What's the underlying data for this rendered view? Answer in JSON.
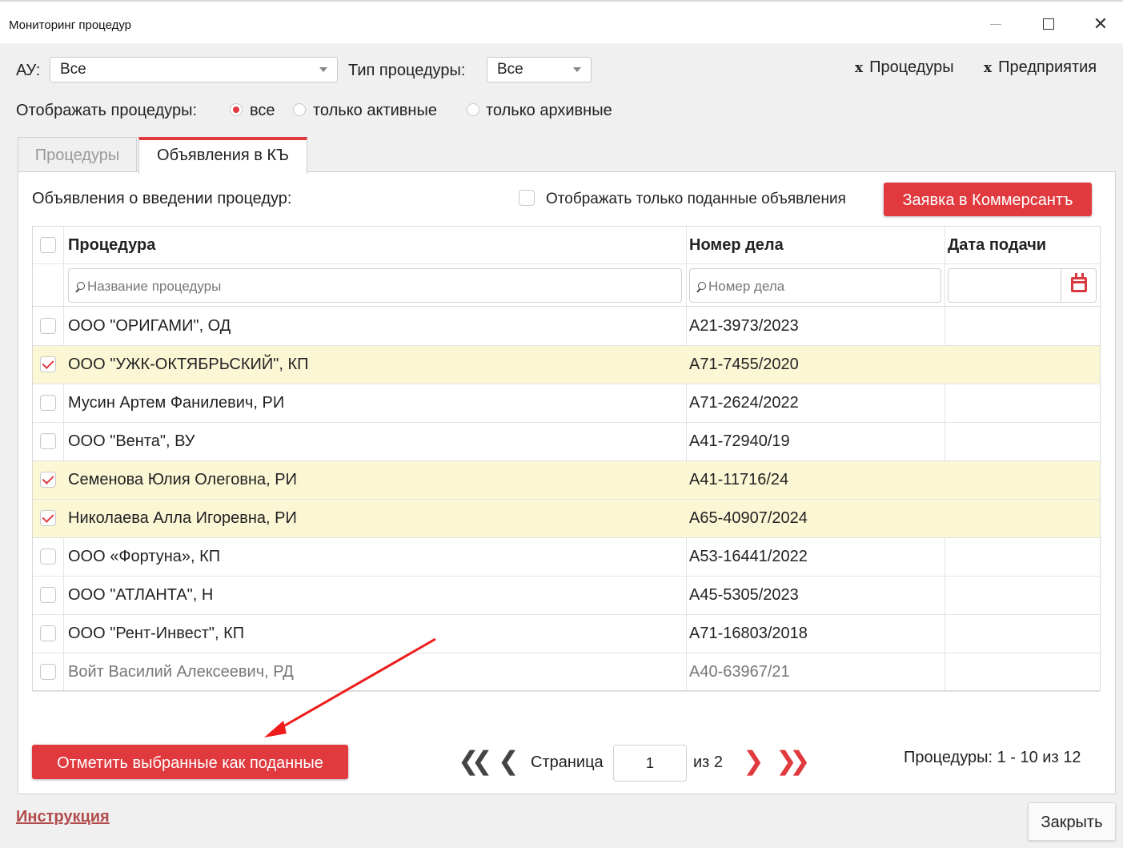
{
  "window": {
    "title": "Мониторинг процедур"
  },
  "filters": {
    "au_label": "АУ:",
    "au_value": "Все",
    "type_label": "Тип процедуры:",
    "type_value": "Все",
    "show_label": "Отображать процедуры:",
    "radio_all": "все",
    "radio_active": "только активные",
    "radio_archive": "только архивные",
    "links": [
      {
        "mark": "x",
        "label": "Процедуры"
      },
      {
        "mark": "x",
        "label": "Предприятия"
      }
    ]
  },
  "tabs": [
    {
      "label": "Процедуры"
    },
    {
      "label": "Объявления в КЪ"
    }
  ],
  "panel": {
    "heading": "Объявления о введении процедур:",
    "only_submitted_label": "Отображать только поданные объявления",
    "kommersant_button": "Заявка в Коммерсантъ"
  },
  "table": {
    "columns": [
      "Процедура",
      "Номер дела",
      "Дата подачи"
    ],
    "filter_name_placeholder": "Название процедуры",
    "filter_case_placeholder": "Номер дела",
    "rows": [
      {
        "checked": false,
        "name": "ООО \"ОРИГАМИ\", ОД",
        "case": "А21-3973/2023",
        "date": ""
      },
      {
        "checked": true,
        "name": "ООО \"УЖК-ОКТЯБРЬСКИЙ\", КП",
        "case": "А71-7455/2020",
        "date": ""
      },
      {
        "checked": false,
        "name": "Мусин Артем Фанилевич, РИ",
        "case": "А71-2624/2022",
        "date": ""
      },
      {
        "checked": false,
        "name": "ООО \"Вента\", ВУ",
        "case": "А41-72940/19",
        "date": ""
      },
      {
        "checked": true,
        "name": "Семенова Юлия Олеговна, РИ",
        "case": "А41-11716/24",
        "date": ""
      },
      {
        "checked": true,
        "name": "Николаева Алла Игоревна, РИ",
        "case": "А65-40907/2024",
        "date": ""
      },
      {
        "checked": false,
        "name": "ООО «Фортуна», КП",
        "case": "А53-16441/2022",
        "date": ""
      },
      {
        "checked": false,
        "name": "ООО \"АТЛАНТА\", Н",
        "case": "А45-5305/2023",
        "date": ""
      },
      {
        "checked": false,
        "name": "ООО \"Рент-Инвест\", КП",
        "case": "А71-16803/2018",
        "date": ""
      },
      {
        "checked": false,
        "name": "Войт Василий Алексеевич, РД",
        "case": "А40-63967/21",
        "date": "",
        "dim": true
      }
    ]
  },
  "footer": {
    "mark_button": "Отметить выбранные как поданные",
    "page_label": "Страница",
    "page_value": "1",
    "page_of": "из 2",
    "count": "Процедуры: 1 - 10 из 12",
    "instruction_link": "Инструкция",
    "close_button": "Закрыть"
  },
  "icons": {
    "first": "double-chevron-left-icon",
    "prev": "chevron-left-icon",
    "next": "chevron-right-icon",
    "last": "double-chevron-right-icon",
    "calendar": "calendar-icon",
    "search": "search-icon"
  },
  "colors": {
    "accent": "#e0393e",
    "selected_row": "#fbf7d5",
    "link": "#b24b4b"
  }
}
